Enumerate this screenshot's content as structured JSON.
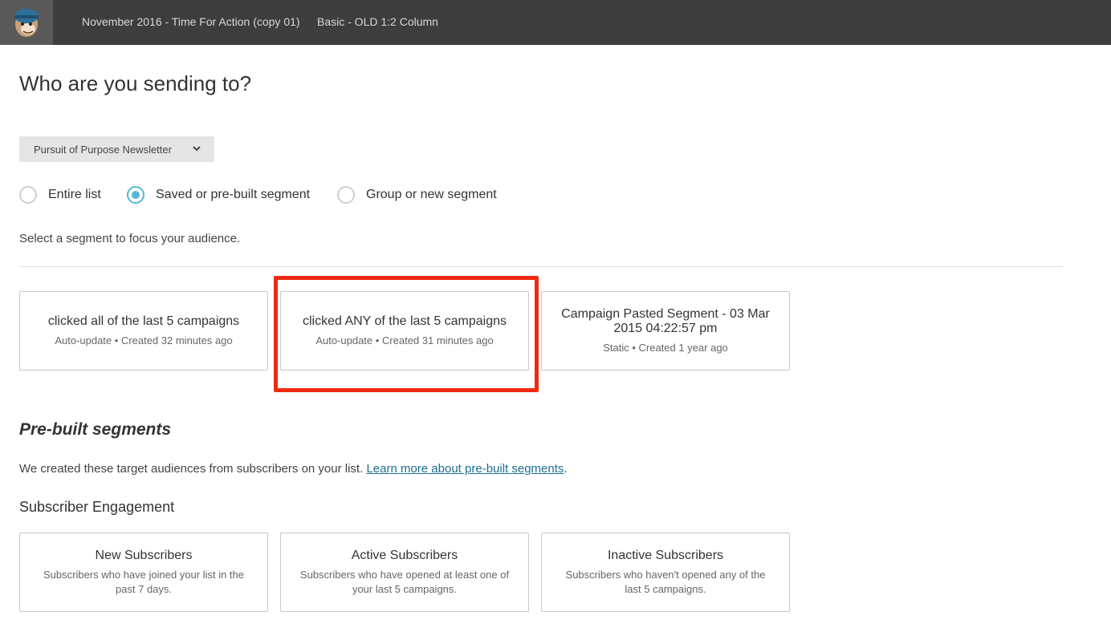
{
  "topbar": {
    "logo_icon": "mailchimp-freddie-logo-icon",
    "campaign_name": "November 2016 - Time For Action (copy 01)",
    "template_name": "Basic - OLD 1:2 Column"
  },
  "page": {
    "heading": "Who are you sending to?",
    "list_select": {
      "value": "Pursuit of Purpose Newsletter",
      "icon": "chevron-down-icon"
    },
    "radios": [
      {
        "label": "Entire list",
        "selected": false
      },
      {
        "label": "Saved or pre-built segment",
        "selected": true
      },
      {
        "label": "Group or new segment",
        "selected": false
      }
    ],
    "helper_text": "Select a segment to focus your audience."
  },
  "saved_segments": [
    {
      "title": "clicked all of the last 5 campaigns",
      "meta": "Auto-update • Created 32 minutes ago"
    },
    {
      "title": "clicked ANY of the last 5 campaigns",
      "meta": "Auto-update • Created 31 minutes ago"
    },
    {
      "title": "Campaign Pasted Segment - 03 Mar 2015 04:22:57 pm",
      "meta": "Static • Created 1 year ago"
    }
  ],
  "highlight_color": "#ef2a12",
  "prebuilt": {
    "heading": "Pre-built segments",
    "description": "We created these target audiences from subscribers on your list.",
    "link_text": "Learn more about pre-built segments",
    "after_link": ".",
    "subheading": "Subscriber Engagement",
    "cards": [
      {
        "title": "New Subscribers",
        "meta": "Subscribers who have joined your list in the past 7 days."
      },
      {
        "title": "Active Subscribers",
        "meta": "Subscribers who have opened at least one of your last 5 campaigns."
      },
      {
        "title": "Inactive Subscribers",
        "meta": "Subscribers who haven't opened any of the last 5 campaigns."
      }
    ]
  }
}
